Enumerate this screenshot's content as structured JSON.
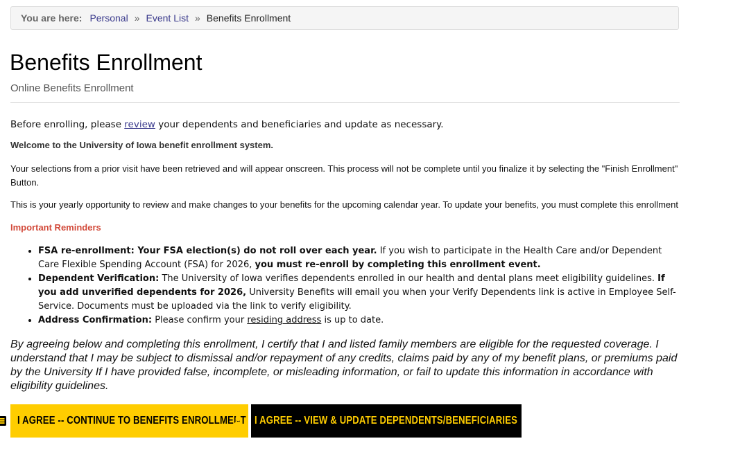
{
  "breadcrumb": {
    "prefix": "You are here:",
    "items": [
      "Personal",
      "Event List"
    ],
    "separator": "»",
    "current": "Benefits Enrollment"
  },
  "header": {
    "title": "Benefits Enrollment",
    "subtitle": "Online Benefits Enrollment"
  },
  "intro": {
    "before": "Before enrolling, please ",
    "link": "review",
    "after": " your dependents and beneficiaries and update as necessary."
  },
  "welcome": "Welcome to the University of Iowa benefit enrollment system.",
  "selection_notice": "Your selections from a prior visit have been retrieved and will appear onscreen. This process will not be complete until you finalize it by selecting the \"Finish Enrollment\" Button.",
  "yearly_notice": "This is your yearly opportunity to review and make changes to your benefits for the upcoming calendar year. To update your benefits, you must complete this enrollment",
  "reminders": {
    "heading": "Important Reminders",
    "fsa": {
      "bold1": "FSA re-enrollment: Your FSA election(s) do not roll over each year.",
      "text1": " If you wish to participate in the Health Care and/or Dependent Care Flexible Spending Account (FSA) for 2026, ",
      "bold2": "you must re-enroll by completing this enrollment event."
    },
    "dependent": {
      "bold1": "Dependent Verification:",
      "text1": " The University of Iowa verifies dependents enrolled in our health and dental plans meet eligibility guidelines. ",
      "bold2": "If you add unverified dependents for 2026,",
      "text2": " University Benefits will email you when your Verify Dependents link is active in Employee Self-Service. Documents must be uploaded via the link to verify eligibility."
    },
    "address": {
      "bold1": "Address Confirmation:",
      "text1": " Please confirm your ",
      "link": "residing address",
      "text2": " is up to date."
    }
  },
  "certification": "By agreeing below and completing this enrollment, I certify that I and listed family members are eligible for the requested coverage. I understand that I may be subject to dismissal and/or repayment of any credits, claims paid by any of my benefit plans, or premiums paid by the University If I have provided false, incomplete, or misleading information, or fail to update this information in accordance with eligibility guidelines.",
  "buttons": {
    "continue": {
      "label": "I AGREE -- CONTINUE TO BENEFITS ENROLLMENT",
      "icon": "list-icon"
    },
    "dependents": {
      "label": "I AGREE -- VIEW & UPDATE DEPENDENTS/BENEFICIARIES",
      "icon": "user-icon"
    }
  },
  "colors": {
    "brand_gold": "#ffcd00",
    "brand_black": "#000000",
    "reminder_red": "#d24a3a",
    "link": "#3a3a8c"
  }
}
